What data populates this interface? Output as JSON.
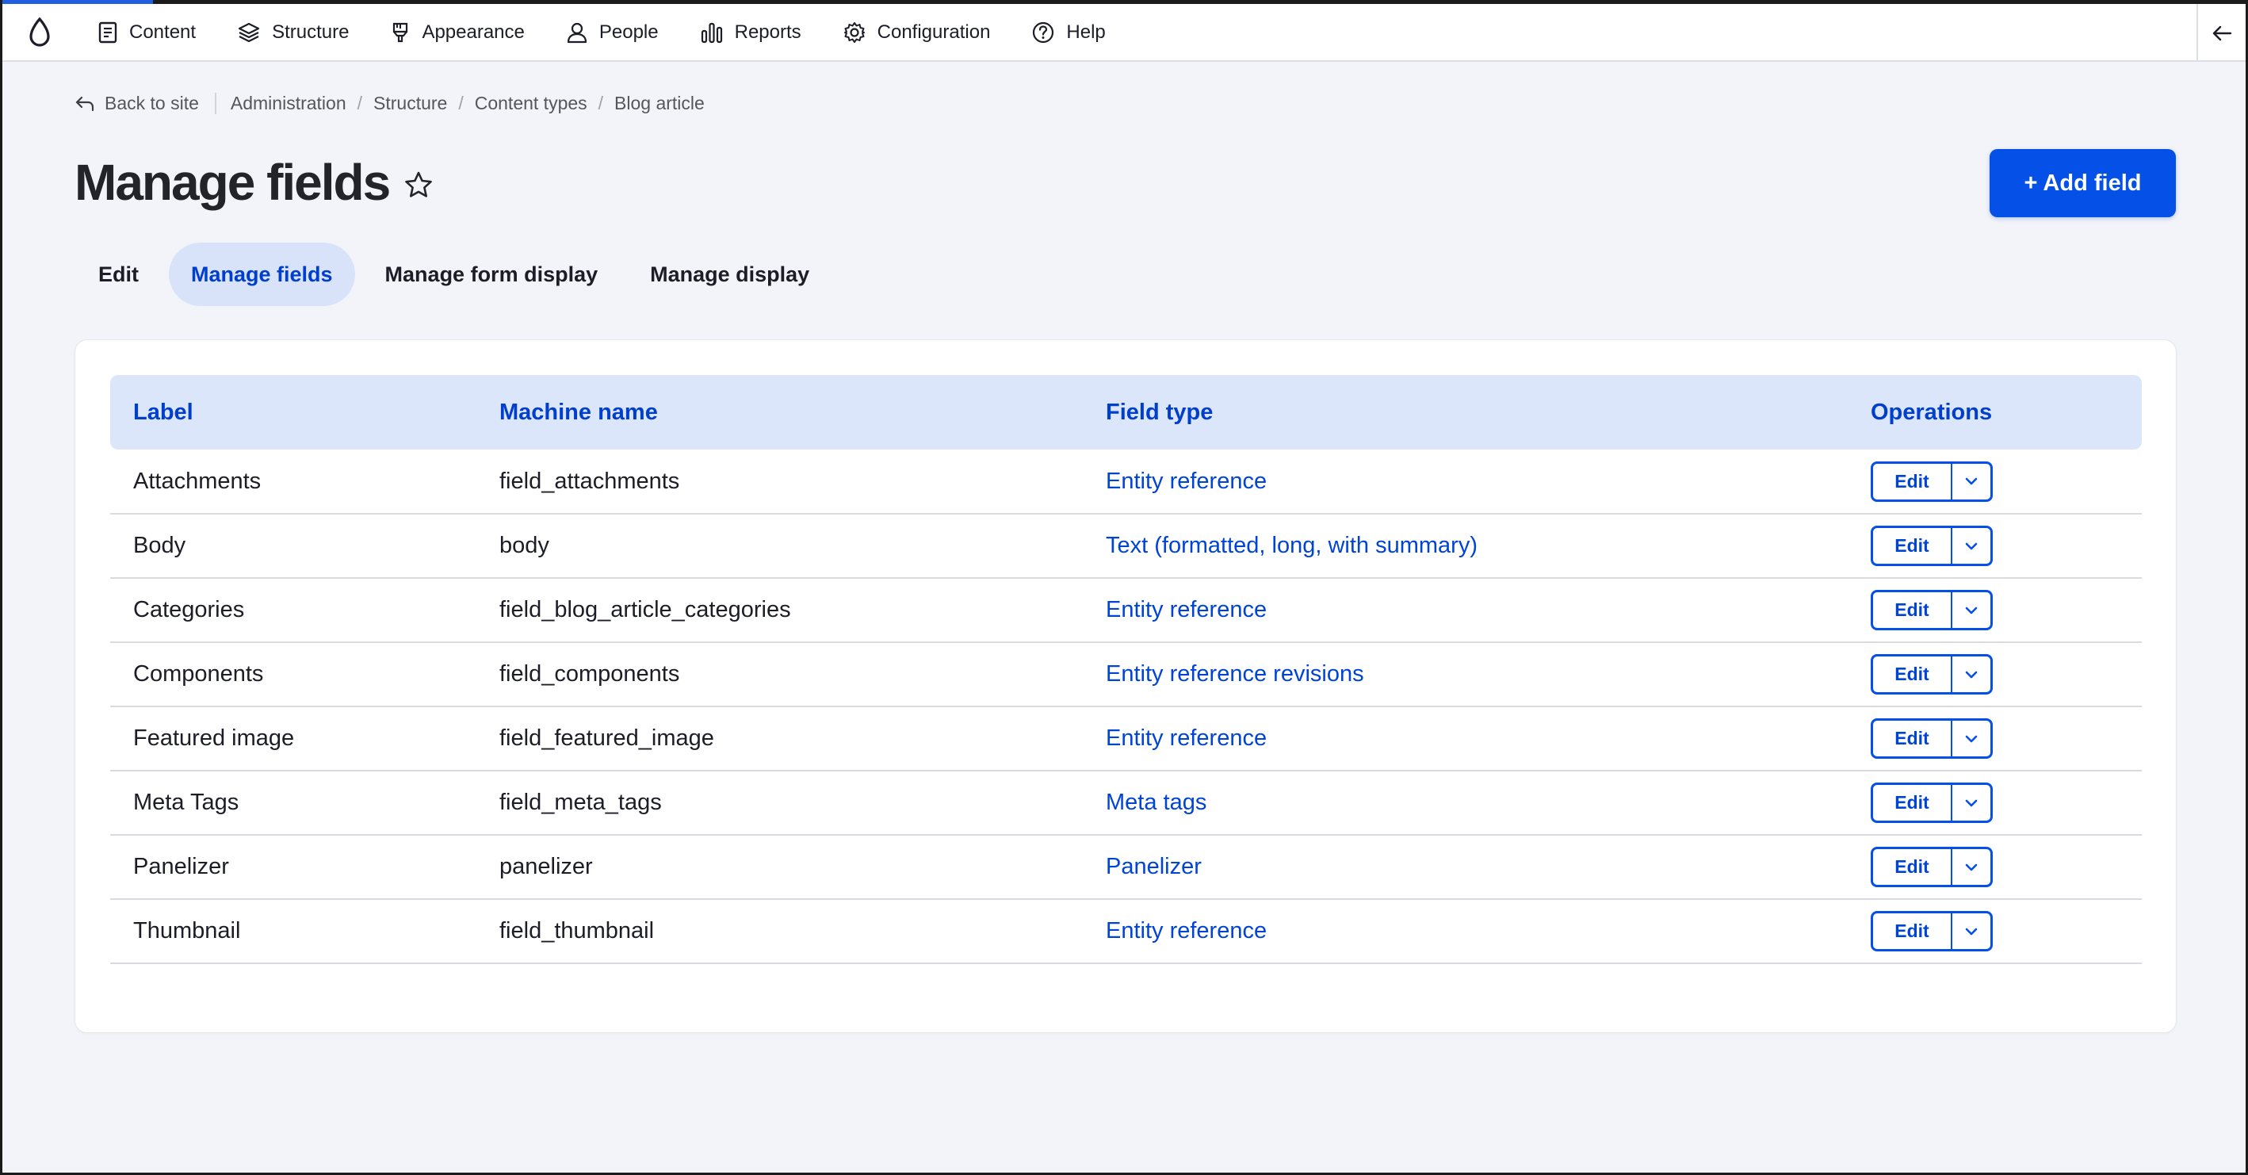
{
  "toolbar": {
    "logo": "drupal-drop-icon",
    "items": [
      {
        "label": "Content",
        "icon": "content-icon"
      },
      {
        "label": "Structure",
        "icon": "structure-icon"
      },
      {
        "label": "Appearance",
        "icon": "appearance-icon"
      },
      {
        "label": "People",
        "icon": "people-icon"
      },
      {
        "label": "Reports",
        "icon": "reports-icon"
      },
      {
        "label": "Configuration",
        "icon": "gear-icon"
      },
      {
        "label": "Help",
        "icon": "help-icon"
      }
    ]
  },
  "breadcrumb": {
    "back_label": "Back to site",
    "items": [
      "Administration",
      "Structure",
      "Content types",
      "Blog article"
    ]
  },
  "page": {
    "title": "Manage fields",
    "add_button": "+ Add field"
  },
  "tabs": [
    {
      "label": "Edit",
      "active": false
    },
    {
      "label": "Manage fields",
      "active": true
    },
    {
      "label": "Manage form display",
      "active": false
    },
    {
      "label": "Manage display",
      "active": false
    }
  ],
  "table": {
    "columns": [
      "Label",
      "Machine name",
      "Field type",
      "Operations"
    ],
    "rows": [
      {
        "label": "Attachments",
        "machine": "field_attachments",
        "type": "Entity reference",
        "op": "Edit"
      },
      {
        "label": "Body",
        "machine": "body",
        "type": "Text (formatted, long, with summary)",
        "op": "Edit"
      },
      {
        "label": "Categories",
        "machine": "field_blog_article_categories",
        "type": "Entity reference",
        "op": "Edit"
      },
      {
        "label": "Components",
        "machine": "field_components",
        "type": "Entity reference revisions",
        "op": "Edit"
      },
      {
        "label": "Featured image",
        "machine": "field_featured_image",
        "type": "Entity reference",
        "op": "Edit"
      },
      {
        "label": "Meta Tags",
        "machine": "field_meta_tags",
        "type": "Meta tags",
        "op": "Edit"
      },
      {
        "label": "Panelizer",
        "machine": "panelizer",
        "type": "Panelizer",
        "op": "Edit"
      },
      {
        "label": "Thumbnail",
        "machine": "field_thumbnail",
        "type": "Entity reference",
        "op": "Edit"
      }
    ]
  },
  "colors": {
    "primary": "#0550e6",
    "link": "#0044d6",
    "header_bg": "#dce6fa",
    "active_tab_bg": "#d8e3fa"
  }
}
